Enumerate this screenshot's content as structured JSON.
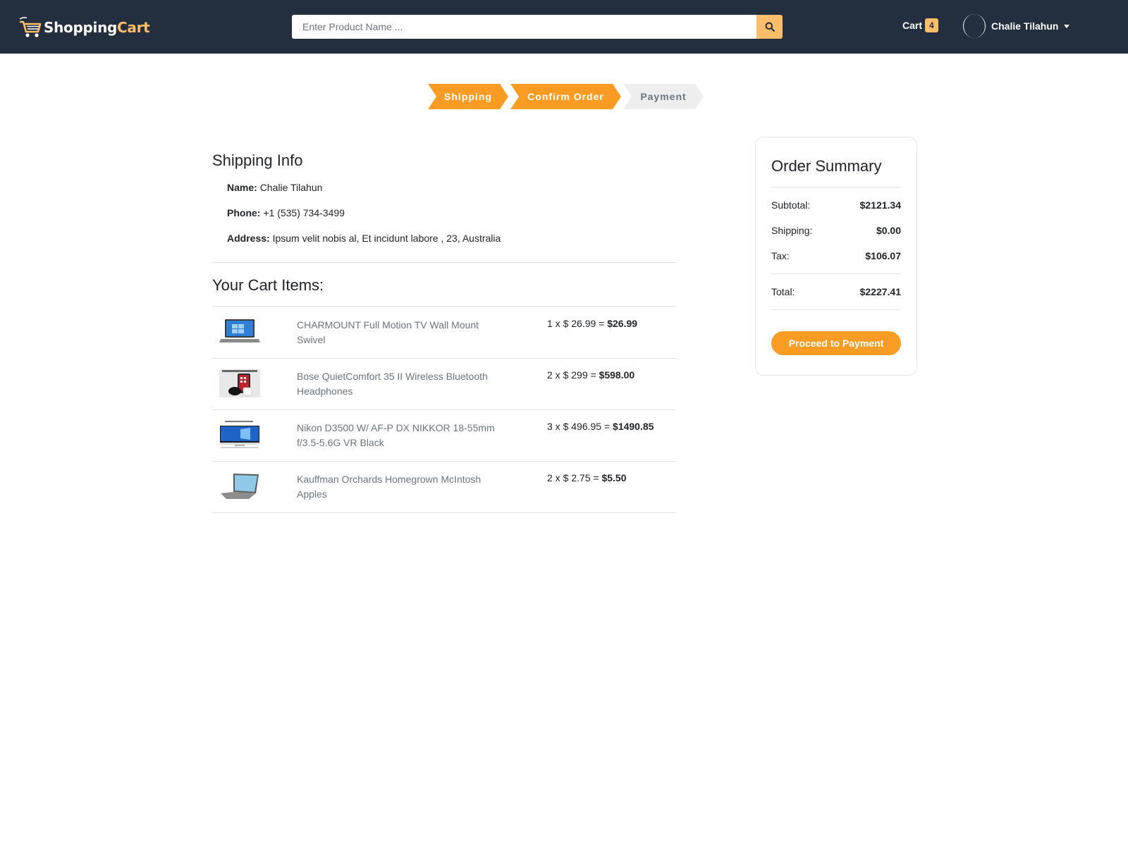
{
  "brand": {
    "part1": "Shopping",
    "part2": "Cart",
    "icon": "shopping-cart-logo-icon"
  },
  "search": {
    "placeholder": "Enter Product Name ...",
    "value": "",
    "icon": "search-icon"
  },
  "nav": {
    "cart_label": "Cart",
    "cart_count": "4",
    "user_name": "Chalie Tilahun"
  },
  "steps": [
    {
      "label": "Shipping",
      "state": "active"
    },
    {
      "label": "Confirm Order",
      "state": "active"
    },
    {
      "label": "Payment",
      "state": "inactive"
    }
  ],
  "shipping": {
    "heading": "Shipping Info",
    "name_label": "Name:",
    "name": "Chalie Tilahun",
    "phone_label": "Phone:",
    "phone": "+1 (535) 734-3499",
    "address_label": "Address:",
    "address": "Ipsum velit nobis al, Et incidunt labore , 23, Australia"
  },
  "cart": {
    "heading": "Your Cart Items:",
    "items": [
      {
        "name": "CHARMOUNT Full Motion TV Wall Mount Swivel",
        "qty_price": "1 x $ 26.99 =",
        "total": "$26.99",
        "thumb": "laptop-image"
      },
      {
        "name": "Bose QuietComfort 35 II Wireless Bluetooth Headphones",
        "qty_price": "2 x $ 299 =",
        "total": "$598.00",
        "thumb": "tablet-earbuds-image"
      },
      {
        "name": "Nikon D3500 W/ AF-P DX NIKKOR 18-55mm f/3.5-5.6G VR Black",
        "qty_price": "3 x $ 496.95 =",
        "total": "$1490.85",
        "thumb": "monitor-image"
      },
      {
        "name": "Kauffman Orchards Homegrown McIntosh Apples",
        "qty_price": "2 x $ 2.75 =",
        "total": "$5.50",
        "thumb": "laptop-angled-image"
      }
    ]
  },
  "summary": {
    "title": "Order Summary",
    "subtotal_label": "Subtotal:",
    "subtotal": "$2121.34",
    "shipping_label": "Shipping:",
    "shipping": "$0.00",
    "tax_label": "Tax:",
    "tax": "$106.07",
    "total_label": "Total:",
    "total": "$2227.41",
    "button": "Proceed to Payment"
  },
  "colors": {
    "navbar": "#232f3e",
    "accent": "#fa9c23",
    "accent_light": "#febd69"
  }
}
